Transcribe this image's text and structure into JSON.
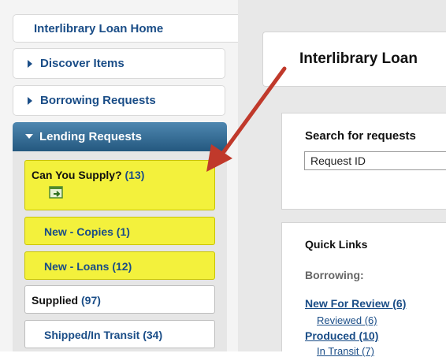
{
  "sidebar": {
    "home_label": "Interlibrary Loan Home",
    "discover_label": "Discover Items",
    "borrowing_label": "Borrowing Requests",
    "lending": {
      "header_label": "Lending Requests",
      "items": [
        {
          "label": "Can You Supply?",
          "count": "(13)",
          "icon": "export-icon",
          "highlighted": true
        },
        {
          "label": "New - Copies (1)",
          "highlighted": true
        },
        {
          "label": "New - Loans (12)",
          "highlighted": true
        },
        {
          "label": "Supplied",
          "count": "(97)",
          "highlighted": false
        },
        {
          "label": "Shipped/In Transit (34)",
          "highlighted": false
        }
      ]
    }
  },
  "main": {
    "title": "Interlibrary Loan",
    "search": {
      "heading": "Search for requests",
      "select_value": "Request ID"
    },
    "quick_links": {
      "heading": "Quick Links",
      "borrowing_label": "Borrowing:",
      "links": [
        "New For Review (6)",
        "Reviewed (6)",
        "Produced (10)",
        "In Transit (7)"
      ]
    }
  },
  "colors": {
    "link_blue": "#1a4d87",
    "highlight_yellow": "#f3f13c",
    "header_blue": "#24587f",
    "annotation_arrow": "#c0392b"
  }
}
